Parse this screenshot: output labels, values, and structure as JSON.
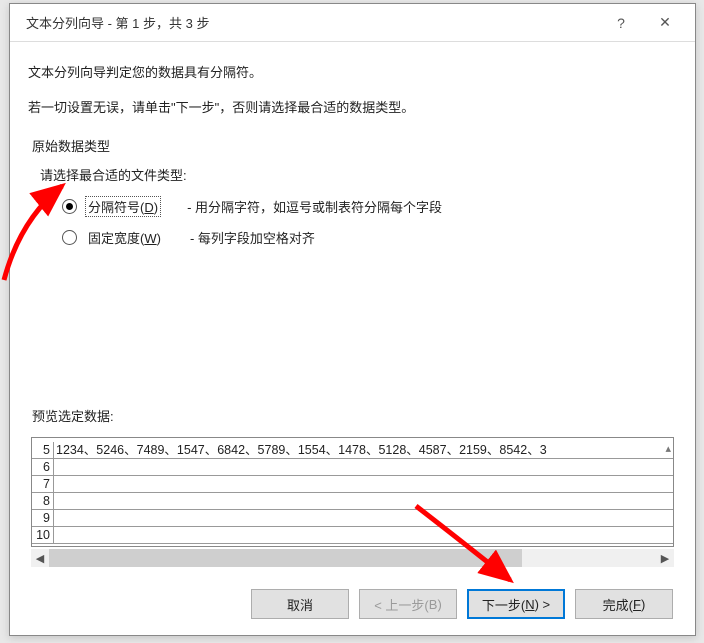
{
  "titlebar": {
    "title": "文本分列向导 - 第 1 步，共 3 步",
    "help": "?",
    "close": "✕"
  },
  "intro": {
    "line1": "文本分列向导判定您的数据具有分隔符。",
    "line2_a": "若一切设置无误，请单击\"下一步\"，否则请选择最合适的数据类型。"
  },
  "section": {
    "original_label": "原始数据类型",
    "choose_label": "请选择最合适的文件类型:"
  },
  "radios": {
    "delimited_label_a": "分隔符号(",
    "delimited_hot": "D",
    "delimited_label_b": ")",
    "delimited_desc": "- 用分隔字符，如逗号或制表符分隔每个字段",
    "fixed_label_a": "固定宽度(",
    "fixed_hot": "W",
    "fixed_label_b": ")",
    "fixed_desc": "- 每列字段加空格对齐"
  },
  "preview": {
    "label": "预览选定数据:",
    "rows": [
      {
        "n": "5",
        "data": "1234、5246、7489、1547、6842、5789、1554、1478、5128、4587、2159、8542、3"
      },
      {
        "n": "6",
        "data": ""
      },
      {
        "n": "7",
        "data": ""
      },
      {
        "n": "8",
        "data": ""
      },
      {
        "n": "9",
        "data": ""
      },
      {
        "n": "10",
        "data": ""
      }
    ],
    "vscroll_hint": "▴"
  },
  "buttons": {
    "cancel": "取消",
    "back_a": "< 上一步(",
    "back_hot": "B",
    "back_b": ")",
    "next_a": "下一步(",
    "next_hot": "N",
    "next_b": ") >",
    "finish_a": "完成(",
    "finish_hot": "F",
    "finish_b": ")"
  }
}
